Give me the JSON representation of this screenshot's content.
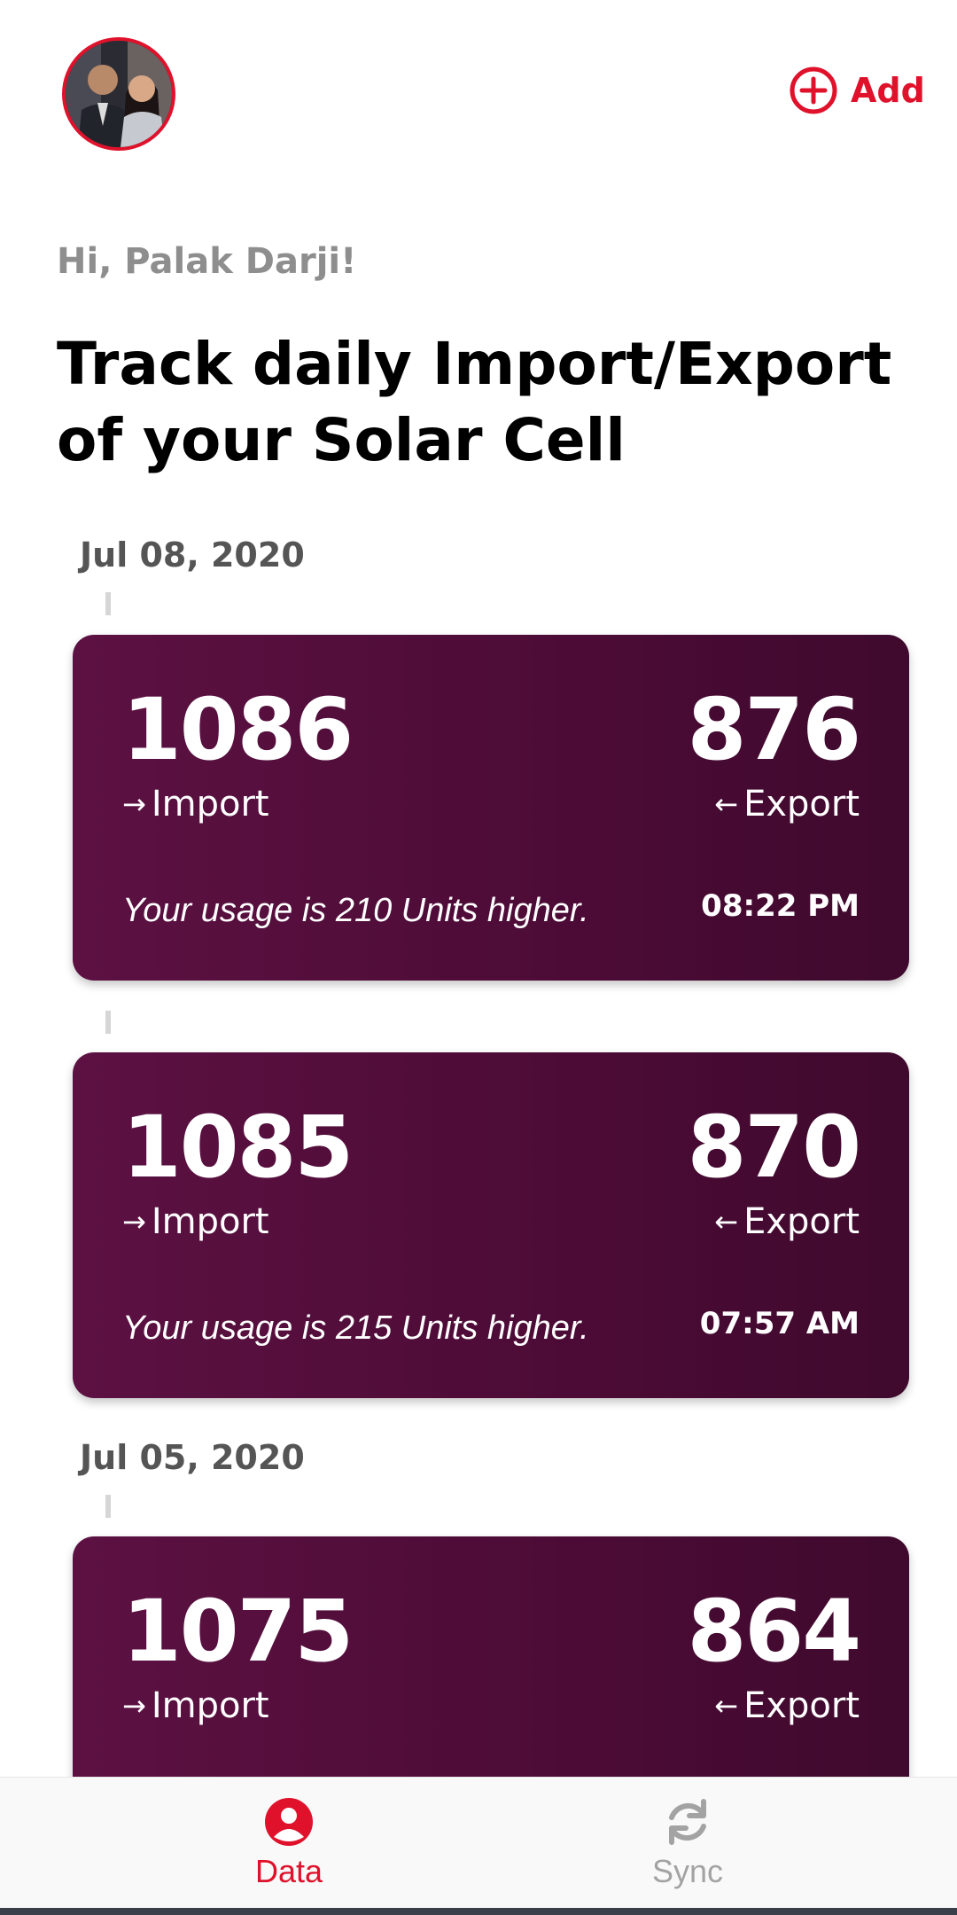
{
  "header": {
    "add_label": "Add",
    "accent_color": "#e0112b",
    "avatar_icon": "avatar-photo"
  },
  "greeting": "Hi, Palak Darji!",
  "headline": "Track daily Import/Export of your Solar Cell",
  "groups": [
    {
      "date": "Jul 08, 2020",
      "entries": [
        {
          "import_value": "1086",
          "import_label": "Import",
          "export_value": "876",
          "export_label": "Export",
          "usage_text": "Your usage is 210 Units higher.",
          "time": "08:22 PM"
        },
        {
          "import_value": "1085",
          "import_label": "Import",
          "export_value": "870",
          "export_label": "Export",
          "usage_text": "Your usage is 215 Units higher.",
          "time": "07:57 AM"
        }
      ]
    },
    {
      "date": "Jul 05, 2020",
      "entries": [
        {
          "import_value": "1075",
          "import_label": "Import",
          "export_value": "864",
          "export_label": "Export"
        }
      ]
    }
  ],
  "icons": {
    "import": "arrow-right-icon",
    "export": "arrow-left-icon"
  },
  "bottom_nav": {
    "items": [
      {
        "label": "Data",
        "icon": "user-circle-icon",
        "active": true
      },
      {
        "label": "Sync",
        "icon": "sync-icon",
        "active": false
      }
    ],
    "active_color": "#e0112b",
    "inactive_color": "#a3a3a3"
  }
}
